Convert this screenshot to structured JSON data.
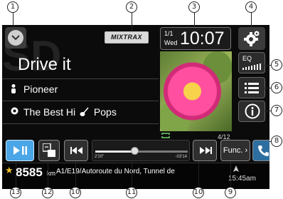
{
  "screen": {
    "mixtrax_label": "MIXTRAX",
    "clock": {
      "date": "1/1",
      "day": "Wed",
      "time": "10:07"
    },
    "eq_label": "EQ",
    "bg_letters": "SD",
    "title": "Drive it",
    "artist": "Pioneer",
    "album": "The Best Hi",
    "genre": "Pops",
    "track_count": "4/12",
    "elapsed": "2'20\"",
    "remaining": "-03'14",
    "progress_fraction": 0.42,
    "func_label": "Func.",
    "distance": "8585",
    "distance_unit": "km",
    "street": "A1/E19/Autoroute du Nord, Tunnel de",
    "clock_bottom": "15:45am",
    "colors": {
      "play_accent": "#4aa6e6",
      "star": "#f3c32b",
      "phone_accent": "#2f6fa0"
    }
  },
  "callouts": [
    "1",
    "2",
    "3",
    "4",
    "5",
    "6",
    "7",
    "8",
    "9",
    "10",
    "11",
    "10",
    "12",
    "13"
  ],
  "icons": [
    "chevron-down-icon",
    "gear-icon",
    "eq-icon",
    "list-icon",
    "info-icon",
    "repeat-icon",
    "play-pause-icon",
    "source-icon",
    "previous-icon",
    "next-icon",
    "phone-icon",
    "star-icon",
    "navigation-icon",
    "person-icon",
    "album-icon",
    "guitar-icon"
  ]
}
